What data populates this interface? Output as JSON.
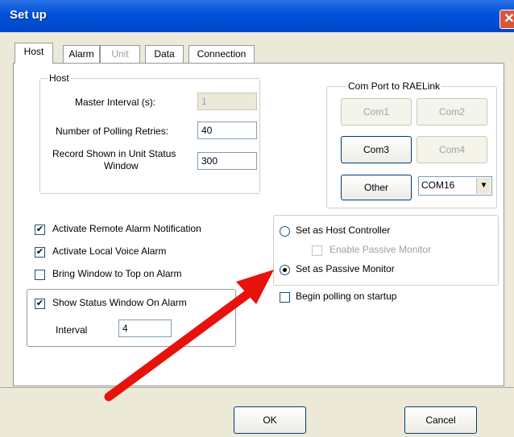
{
  "window": {
    "title": "Set up",
    "close_glyph": "✕"
  },
  "tabs": [
    {
      "label": "Host",
      "active": true,
      "enabled": true
    },
    {
      "label": "Alarm",
      "active": false,
      "enabled": true
    },
    {
      "label": "Unit",
      "active": false,
      "enabled": false
    },
    {
      "label": "Data",
      "active": false,
      "enabled": true
    },
    {
      "label": "Connection",
      "active": false,
      "enabled": true
    }
  ],
  "host_group": {
    "legend": "Host",
    "master_interval_label": "Master Interval (s):",
    "master_interval_value": "1",
    "polling_retries_label": "Number of Polling Retries:",
    "polling_retries_value": "40",
    "record_shown_label_1": "Record Shown in Unit Status",
    "record_shown_label_2": "Window",
    "record_shown_value": "300"
  },
  "com_group": {
    "legend": "Com Port to RAELink",
    "com1": "Com1",
    "com2": "Com2",
    "com3": "Com3",
    "com4": "Com4",
    "other": "Other",
    "selected_port": "COM16",
    "arrow_glyph": "▼"
  },
  "checks": {
    "remote_alarm": {
      "label": "Activate Remote Alarm Notification",
      "checked": true
    },
    "local_voice": {
      "label": "Activate Local Voice Alarm",
      "checked": true
    },
    "bring_top": {
      "label": "Bring Window to Top on Alarm",
      "checked": false
    },
    "show_status": {
      "label": "Show Status Window On Alarm",
      "checked": true
    },
    "interval_label": "Interval",
    "interval_value": "4",
    "begin_polling": {
      "label": "Begin polling on startup",
      "checked": false
    }
  },
  "mode_group": {
    "host_controller": "Set as Host Controller",
    "enable_passive": "Enable Passive Monitor",
    "passive_monitor": "Set as Passive Monitor",
    "selected": "passive_monitor"
  },
  "footer": {
    "ok": "OK",
    "cancel": "Cancel"
  },
  "annotation": {
    "arrow_color": "#e8120c",
    "arrow_target": "Set as Passive Monitor"
  },
  "check_glyph": "✔"
}
